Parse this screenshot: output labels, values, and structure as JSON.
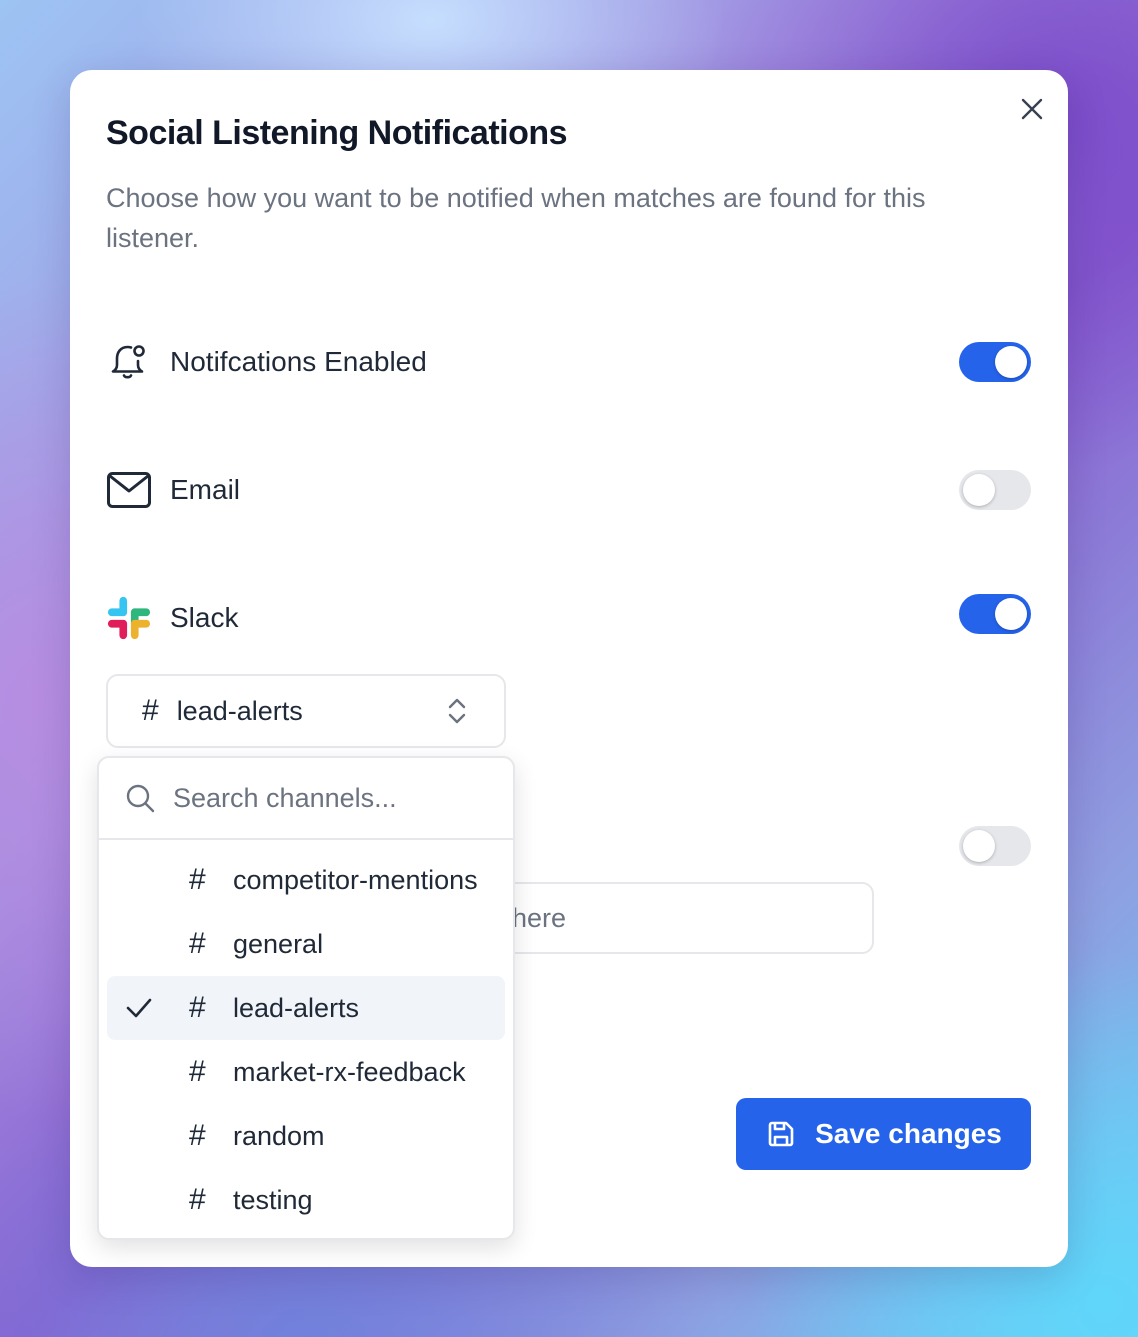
{
  "modal": {
    "title": "Social Listening Notifications",
    "description": "Choose how you want to be notified when matches are found for this listener."
  },
  "settings": {
    "notifications": {
      "label": "Notifcations Enabled",
      "icon": "bell-icon",
      "enabled": true
    },
    "email": {
      "label": "Email",
      "icon": "mail-icon",
      "enabled": false
    },
    "slack": {
      "label": "Slack",
      "icon": "slack-logo",
      "enabled": true
    },
    "hidden_toggle": {
      "enabled": false
    }
  },
  "slack_channel": {
    "selected": "lead-alerts",
    "search_placeholder": "Search channels...",
    "channels": [
      {
        "name": "competitor-mentions",
        "selected": false
      },
      {
        "name": "general",
        "selected": false
      },
      {
        "name": "lead-alerts",
        "selected": true
      },
      {
        "name": "market-rx-feedback",
        "selected": false
      },
      {
        "name": "random",
        "selected": false
      },
      {
        "name": "testing",
        "selected": false
      }
    ]
  },
  "partial_input": {
    "visible_text": "here"
  },
  "footer": {
    "save_label": "Save changes"
  },
  "colors": {
    "accent": "#2563eb",
    "toggle_off": "#e5e7eb",
    "selected_row": "#f1f4f9"
  }
}
